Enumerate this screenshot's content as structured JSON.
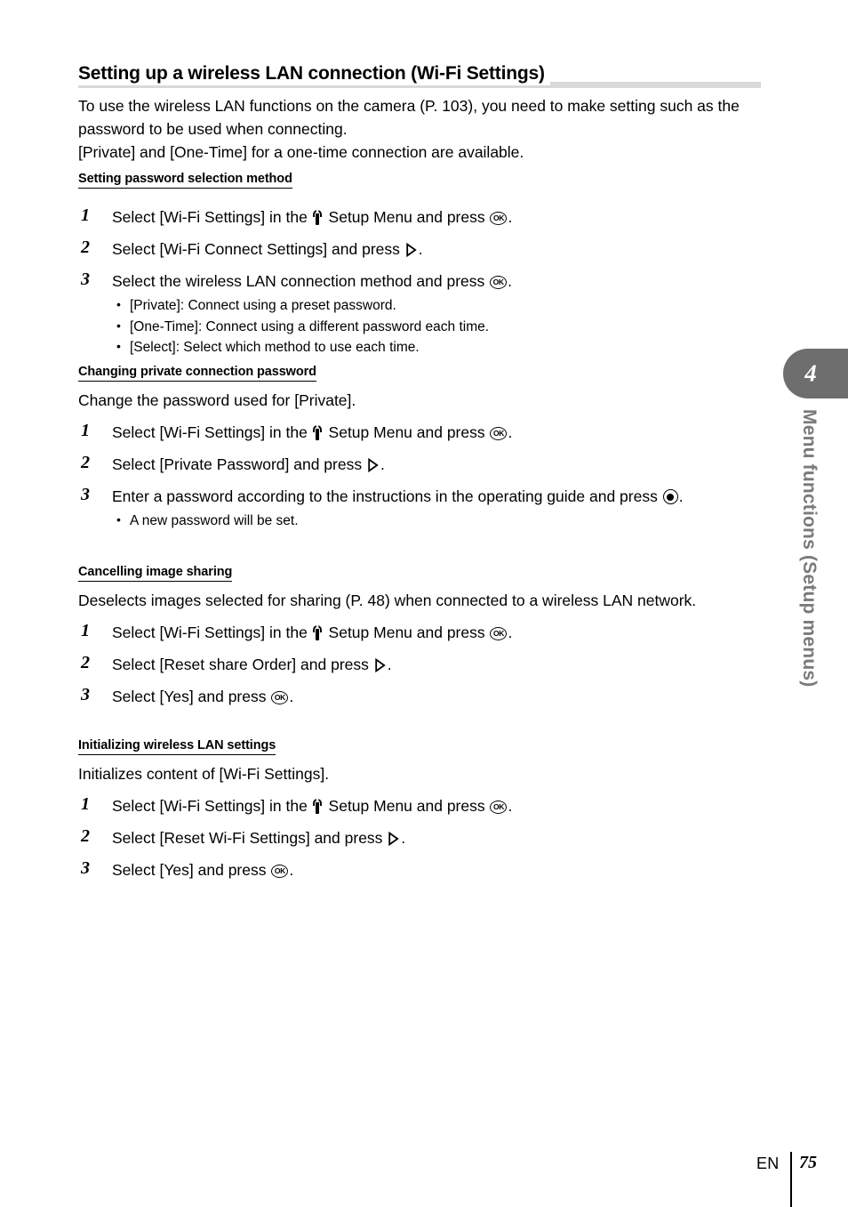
{
  "page": {
    "title": "Setting up a wireless LAN connection (Wi-Fi Settings)",
    "intro_line1": "To use the wireless LAN functions on the camera (P. 103), you need to make setting such as the password to be used when connecting.",
    "intro_line2": "[Private] and [One-Time] for a one-time connection are available."
  },
  "icons": {
    "setup_menu": "wrench-icon",
    "ok_button": "OK",
    "center_button": "dot-button-icon",
    "right_arrow": "right-triangle-icon"
  },
  "sections": [
    {
      "heading": "Setting password selection method",
      "description": "",
      "steps": [
        {
          "num": "1",
          "text_before_wrench": "Select [Wi-Fi Settings] in the ",
          "text_after_wrench": " Setup Menu and press ",
          "text_end": ".",
          "bullets": []
        },
        {
          "num": "2",
          "text_before_arrow": "Select [Wi-Fi Connect Settings] and press ",
          "text_end": ".",
          "bullets": []
        },
        {
          "num": "3",
          "text_before_ok": "Select the wireless LAN connection method and press ",
          "text_end": ".",
          "bullets": [
            "[Private]: Connect using a preset password.",
            "[One-Time]: Connect using a different password each time.",
            "[Select]: Select which method to use each time."
          ]
        }
      ]
    },
    {
      "heading": "Changing private connection password",
      "description": "Change the password used for [Private].",
      "steps": [
        {
          "num": "1",
          "text_before_wrench": "Select [Wi-Fi Settings] in the ",
          "text_after_wrench": " Setup Menu and press ",
          "text_end": ".",
          "bullets": []
        },
        {
          "num": "2",
          "text_before_arrow": "Select [Private Password] and press ",
          "text_end": ".",
          "bullets": []
        },
        {
          "num": "3",
          "text_before_dot": "Enter a password according to the instructions in the operating guide and press ",
          "text_end": ".",
          "bullets": [
            "A new password will be set."
          ]
        }
      ]
    },
    {
      "heading": "Cancelling image sharing",
      "description": "Deselects images selected for sharing (P. 48) when connected to a wireless LAN network.",
      "steps": [
        {
          "num": "1",
          "text_before_wrench": "Select [Wi-Fi Settings] in the ",
          "text_after_wrench": " Setup Menu and press ",
          "text_end": ".",
          "bullets": []
        },
        {
          "num": "2",
          "text_before_arrow": "Select [Reset share Order] and press ",
          "text_end": ".",
          "bullets": []
        },
        {
          "num": "3",
          "text_before_ok": "Select [Yes] and press ",
          "text_end": ".",
          "bullets": []
        }
      ]
    },
    {
      "heading": "Initializing wireless LAN settings",
      "description": "Initializes content of [Wi-Fi Settings].",
      "steps": [
        {
          "num": "1",
          "text_before_wrench": "Select [Wi-Fi Settings] in the ",
          "text_after_wrench": " Setup Menu and press ",
          "text_end": ".",
          "bullets": []
        },
        {
          "num": "2",
          "text_before_arrow": "Select [Reset Wi-Fi Settings] and press ",
          "text_end": ".",
          "bullets": []
        },
        {
          "num": "3",
          "text_before_ok": "Select [Yes] and press ",
          "text_end": ".",
          "bullets": []
        }
      ]
    }
  ],
  "chapter_tab": {
    "number": "4",
    "label": "Menu functions (Setup menus)",
    "color": "#6e6e6e",
    "label_color": "#7a7a7a"
  },
  "footer": {
    "language": "EN",
    "page_number": "75"
  }
}
